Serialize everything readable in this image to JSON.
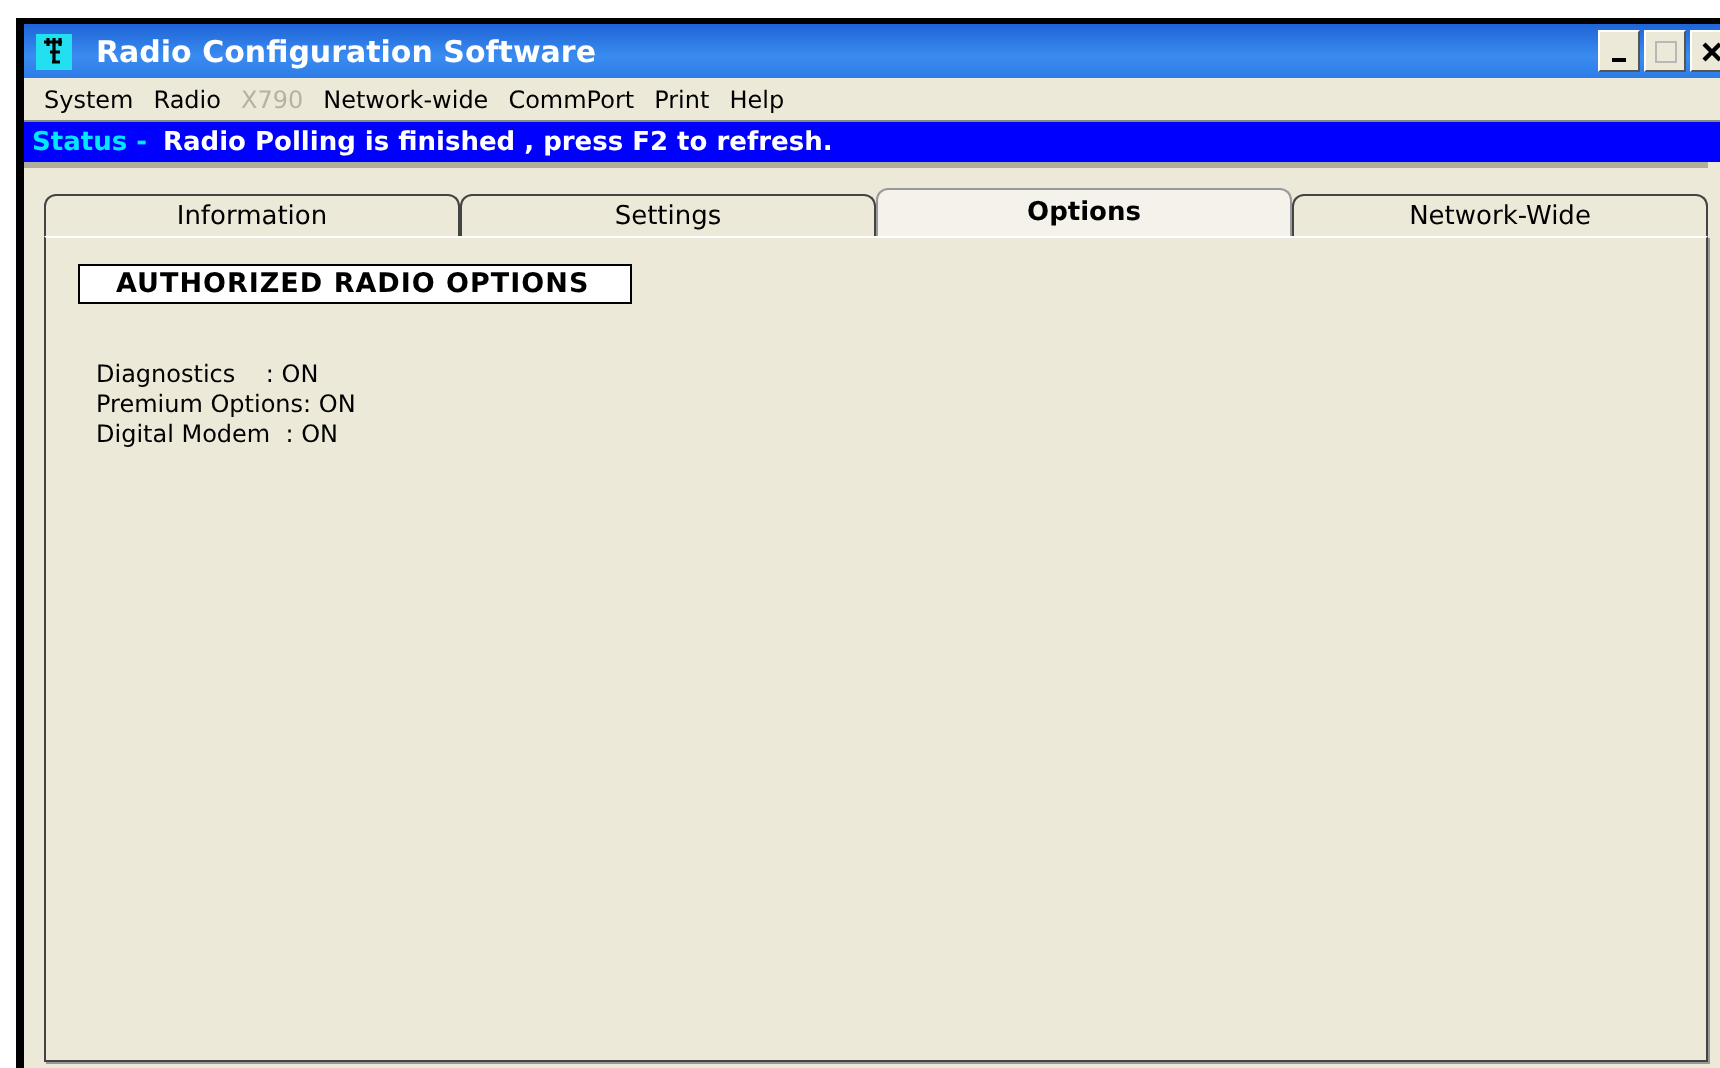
{
  "window": {
    "title": "Radio Configuration Software"
  },
  "menu": [
    {
      "label": "System",
      "disabled": false
    },
    {
      "label": "Radio",
      "disabled": false
    },
    {
      "label": "X790",
      "disabled": true
    },
    {
      "label": "Network-wide",
      "disabled": false
    },
    {
      "label": "CommPort",
      "disabled": false
    },
    {
      "label": "Print",
      "disabled": false
    },
    {
      "label": "Help",
      "disabled": false
    }
  ],
  "status": {
    "label": "Status -",
    "message": "Radio Polling is finished , press F2 to refresh."
  },
  "tabs": [
    {
      "label": "Information",
      "selected": false
    },
    {
      "label": "Settings",
      "selected": false
    },
    {
      "label": "Options",
      "selected": true
    },
    {
      "label": "Network-Wide",
      "selected": false
    }
  ],
  "panel": {
    "heading": "AUTHORIZED RADIO OPTIONS",
    "lines": [
      "Diagnostics    : ON",
      "Premium Options: ON",
      "Digital Modem  : ON"
    ]
  }
}
